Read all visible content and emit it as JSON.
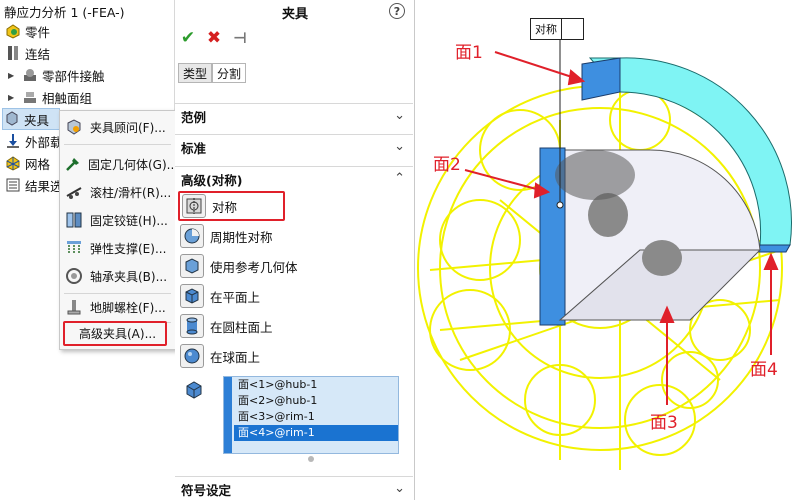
{
  "tree": {
    "title": "静应力分析 1 (-FEA-)",
    "items": [
      {
        "label": "零件"
      },
      {
        "label": "连结"
      },
      {
        "label": "零部件接触"
      },
      {
        "label": "相触面组"
      },
      {
        "label": "夹具"
      },
      {
        "label": "外部载"
      },
      {
        "label": "网格"
      },
      {
        "label": "结果选"
      }
    ]
  },
  "context_menu": {
    "items": [
      {
        "label": "夹具顾问(F)..."
      },
      {
        "label": "固定几何体(G)..."
      },
      {
        "label": "滚柱/滑杆(R)..."
      },
      {
        "label": "固定铰链(H)..."
      },
      {
        "label": "弹性支撑(E)..."
      },
      {
        "label": "轴承夹具(B)..."
      },
      {
        "label": "地脚螺栓(F)..."
      },
      {
        "label": "高级夹具(A)..."
      }
    ]
  },
  "property_manager": {
    "title": "夹具",
    "help": "?",
    "tabs": [
      "类型",
      "分割"
    ],
    "sections": {
      "examples": "范例",
      "standard": "标准",
      "advanced": "高级(对称)",
      "symbol": "符号设定"
    },
    "advanced_options": [
      {
        "label": "对称"
      },
      {
        "label": "周期性对称"
      },
      {
        "label": "使用参考几何体"
      },
      {
        "label": "在平面上"
      },
      {
        "label": "在圆柱面上"
      },
      {
        "label": "在球面上"
      }
    ],
    "faces": [
      "面<1>@hub-1",
      "面<2>@hub-1",
      "面<3>@rim-1",
      "面<4>@rim-1"
    ],
    "selected_face_index": 3
  },
  "viewport": {
    "symmetry_label": "对称",
    "annotations": [
      "面1",
      "面2",
      "面3",
      "面4"
    ]
  },
  "colors": {
    "highlight_red": "#e0202a",
    "mesh_yellow": "#f2f200",
    "rim_cyan": "#7ff4f4",
    "hub_blue": "#3e8fe0",
    "selection_blue": "#1a73d1"
  }
}
